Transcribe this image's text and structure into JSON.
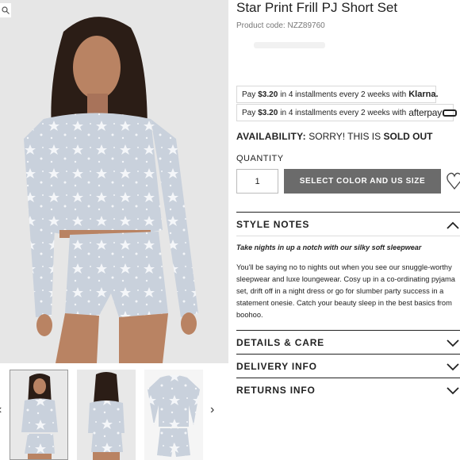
{
  "product": {
    "title": "Star Print Frill PJ Short Set",
    "code": "Product code: NZZ89760"
  },
  "gallery": {
    "zoom_icon": "magnifier-icon",
    "thumbnails": [
      {
        "alt": "front view"
      },
      {
        "alt": "back view"
      },
      {
        "alt": "flat lay"
      }
    ],
    "prev_icon": "chevron-left-icon",
    "next_icon": "chevron-right-icon"
  },
  "payments": {
    "klarna": {
      "prefix": "Pay",
      "amount": "$3.20",
      "suffix": "in 4 installments every 2 weeks with",
      "brand": "Klarna."
    },
    "afterpay": {
      "prefix": "Pay",
      "amount": "$3.20",
      "suffix": "in 4 installments every 2 weeks with",
      "brand": "afterpay"
    }
  },
  "availability": {
    "label": "AVAILABILITY:",
    "status_prefix": "SORRY! THIS IS",
    "status": "SOLD OUT"
  },
  "quantity": {
    "label": "QUANTITY",
    "value": "1"
  },
  "cta": {
    "select_label": "SELECT COLOR AND US SIZE",
    "wishlist_icon": "heart-icon"
  },
  "sections": {
    "style_notes": {
      "heading": "STYLE NOTES",
      "subheading": "Take nights in up a notch with our silky soft sleepwear",
      "body": "You'll be saying no to nights out when you see our snuggle-worthy sleepwear and luxe loungewear. Cosy up in a co-ordinating pyjama set, drift off in a night dress or go for slumber party success in a statement onesie. Catch your beauty sleep in the best basics from boohoo."
    },
    "details": {
      "heading": "DETAILS & CARE"
    },
    "delivery": {
      "heading": "DELIVERY INFO"
    },
    "returns": {
      "heading": "RETURNS INFO"
    }
  },
  "colors": {
    "button_bg": "#6b6b6b",
    "garment": "#c9d1dc",
    "image_bg": "#e6e6e6"
  }
}
